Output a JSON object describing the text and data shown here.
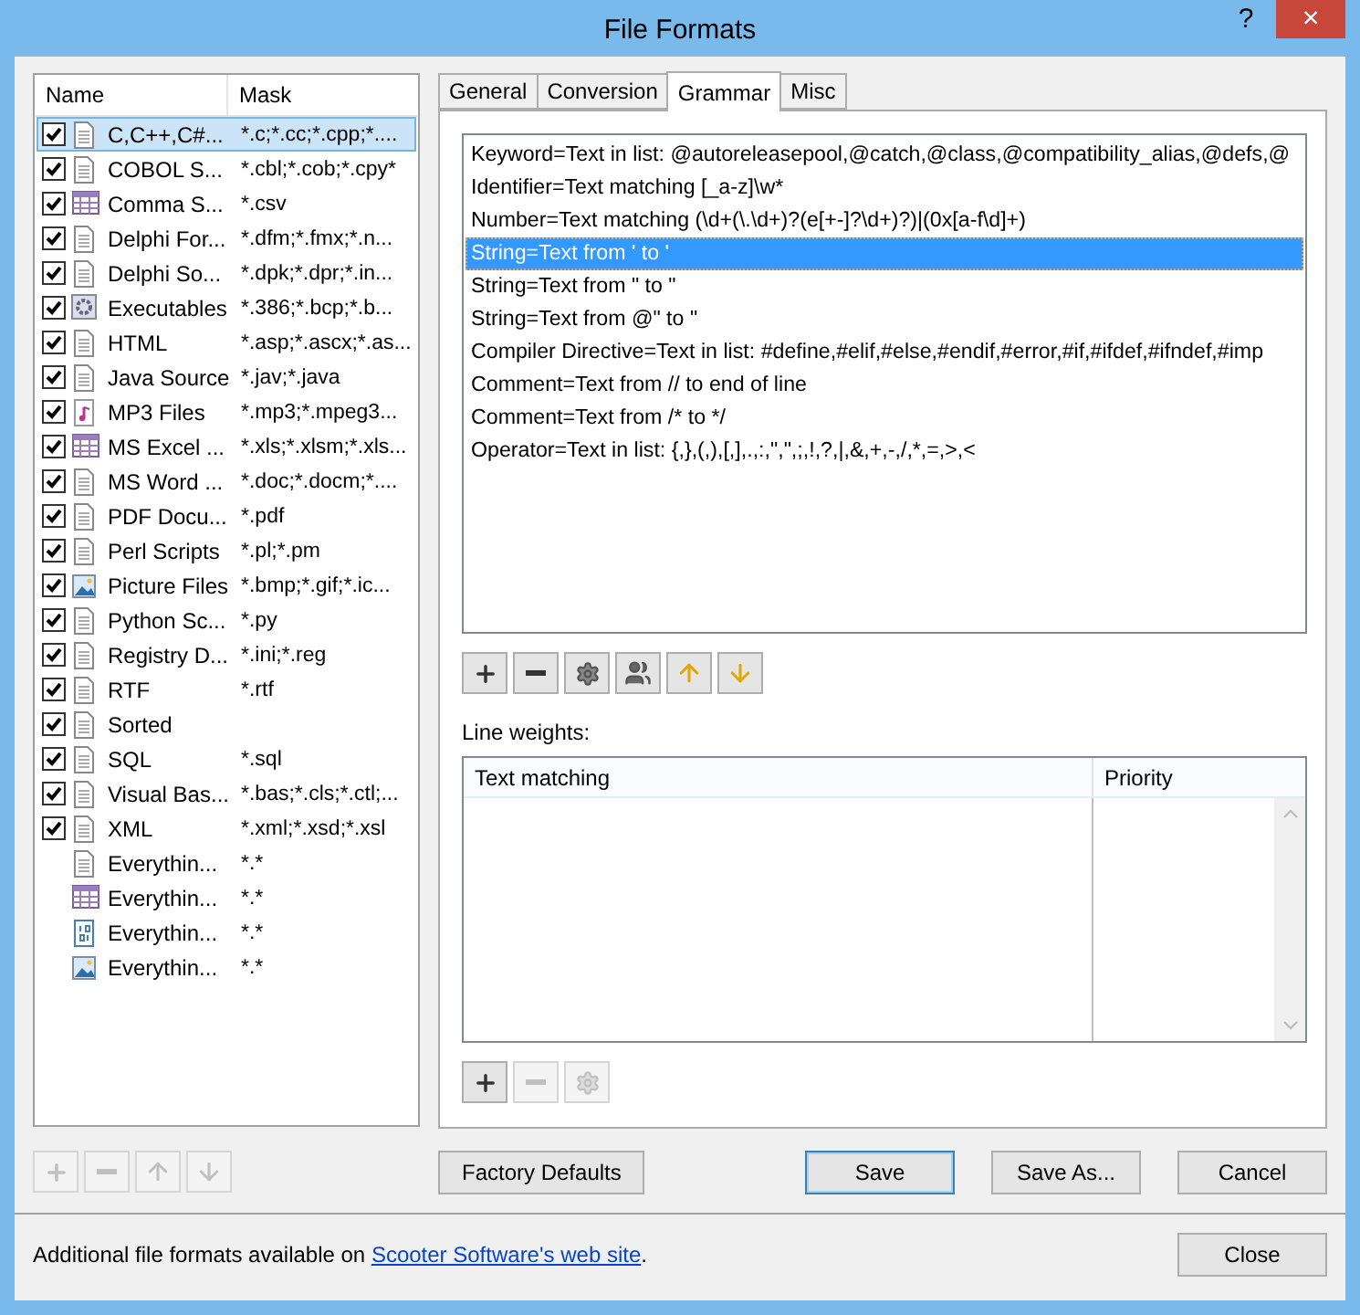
{
  "window": {
    "title": "File Formats",
    "help": "?",
    "close": "×"
  },
  "formats": {
    "columns": [
      "Name",
      "Mask"
    ],
    "items": [
      {
        "name": "C,C++,C#...",
        "mask": "*.c;*.cc;*.cpp;*....",
        "kind": "doc",
        "checked": true,
        "selected": true
      },
      {
        "name": "COBOL S...",
        "mask": "*.cbl;*.cob;*.cpy*",
        "kind": "doc",
        "checked": true,
        "selected": false
      },
      {
        "name": "Comma S...",
        "mask": "*.csv",
        "kind": "table",
        "checked": true,
        "selected": false
      },
      {
        "name": "Delphi For...",
        "mask": "*.dfm;*.fmx;*.n...",
        "kind": "doc",
        "checked": true,
        "selected": false
      },
      {
        "name": "Delphi So...",
        "mask": "*.dpk;*.dpr;*.in...",
        "kind": "doc",
        "checked": true,
        "selected": false
      },
      {
        "name": "Executables",
        "mask": "*.386;*.bcp;*.b...",
        "kind": "exe",
        "checked": true,
        "selected": false
      },
      {
        "name": "HTML",
        "mask": "*.asp;*.ascx;*.as...",
        "kind": "doc",
        "checked": true,
        "selected": false
      },
      {
        "name": "Java Source",
        "mask": "*.jav;*.java",
        "kind": "doc",
        "checked": true,
        "selected": false
      },
      {
        "name": "MP3 Files",
        "mask": "*.mp3;*.mpeg3...",
        "kind": "music",
        "checked": true,
        "selected": false
      },
      {
        "name": "MS Excel ...",
        "mask": "*.xls;*.xlsm;*.xls...",
        "kind": "table",
        "checked": true,
        "selected": false
      },
      {
        "name": "MS Word ...",
        "mask": "*.doc;*.docm;*....",
        "kind": "doc",
        "checked": true,
        "selected": false
      },
      {
        "name": "PDF Docu...",
        "mask": "*.pdf",
        "kind": "doc",
        "checked": true,
        "selected": false
      },
      {
        "name": "Perl Scripts",
        "mask": "*.pl;*.pm",
        "kind": "doc",
        "checked": true,
        "selected": false
      },
      {
        "name": "Picture Files",
        "mask": "*.bmp;*.gif;*.ic...",
        "kind": "picture",
        "checked": true,
        "selected": false
      },
      {
        "name": "Python Sc...",
        "mask": "*.py",
        "kind": "doc",
        "checked": true,
        "selected": false
      },
      {
        "name": "Registry D...",
        "mask": "*.ini;*.reg",
        "kind": "doc",
        "checked": true,
        "selected": false
      },
      {
        "name": "RTF",
        "mask": "*.rtf",
        "kind": "doc",
        "checked": true,
        "selected": false
      },
      {
        "name": "Sorted",
        "kind": "doc",
        "checked": true,
        "selected": false
      },
      {
        "name": "SQL",
        "mask": "*.sql",
        "kind": "doc",
        "checked": true,
        "selected": false
      },
      {
        "name": "Visual Bas...",
        "mask": "*.bas;*.cls;*.ctl;...",
        "kind": "doc",
        "checked": true,
        "selected": false
      },
      {
        "name": "XML",
        "mask": "*.xml;*.xsd;*.xsl",
        "kind": "doc",
        "checked": true,
        "selected": false
      },
      {
        "name": "Everythin...",
        "mask": "*.*",
        "kind": "doc",
        "selected": false
      },
      {
        "name": "Everythin...",
        "mask": "*.*",
        "kind": "table",
        "selected": false
      },
      {
        "name": "Everythin...",
        "mask": "*.*",
        "kind": "binary",
        "selected": false
      },
      {
        "name": "Everythin...",
        "mask": "*.*",
        "kind": "picture",
        "selected": false
      }
    ],
    "toolbar": [
      {
        "kind": "add",
        "disabled": true
      },
      {
        "kind": "remove",
        "disabled": true
      },
      {
        "kind": "up",
        "disabled": true
      },
      {
        "kind": "down",
        "disabled": true
      }
    ]
  },
  "tabs": [
    {
      "label": "General",
      "selected": false
    },
    {
      "label": "Conversion",
      "selected": false
    },
    {
      "label": "Grammar",
      "selected": true
    },
    {
      "label": "Misc",
      "selected": false
    }
  ],
  "grammar": {
    "rules": [
      {
        "text": "Keyword=Text in list: @autoreleasepool,@catch,@class,@compatibility_alias,@defs,@",
        "selected": false
      },
      {
        "text": "Identifier=Text matching [_a-z]\\w*",
        "selected": false
      },
      {
        "text": "Number=Text matching (\\d+(\\.\\d+)?(e[+-]?\\d+)?)|(0x[a-f\\d]+)",
        "selected": false
      },
      {
        "text": "String=Text from ' to '",
        "selected": true
      },
      {
        "text": "String=Text from \" to \"",
        "selected": false
      },
      {
        "text": "String=Text from @\" to \"",
        "selected": false
      },
      {
        "text": "Compiler Directive=Text in list: #define,#elif,#else,#endif,#error,#if,#ifdef,#ifndef,#imp",
        "selected": false
      },
      {
        "text": "Comment=Text from // to end of line",
        "selected": false
      },
      {
        "text": "Comment=Text from /* to */",
        "selected": false
      },
      {
        "text": "Operator=Text in list: {,},(,),[,],.,:,\",\",;,!,?,|,&,+,-,/,*,=,>,<",
        "selected": false
      }
    ],
    "toolbar": [
      {
        "kind": "add",
        "disabled": false
      },
      {
        "kind": "remove",
        "disabled": false
      },
      {
        "kind": "settings",
        "disabled": false
      },
      {
        "kind": "users",
        "disabled": false
      },
      {
        "kind": "up",
        "disabled": false
      },
      {
        "kind": "down",
        "disabled": false
      }
    ],
    "weights_label": "Line weights:",
    "weights_columns": [
      "Text matching",
      "Priority"
    ],
    "weights_toolbar": [
      {
        "kind": "add",
        "disabled": false
      },
      {
        "kind": "remove",
        "disabled": true
      },
      {
        "kind": "settings",
        "disabled": true
      }
    ]
  },
  "buttons": [
    {
      "label": "Factory Defaults",
      "focused": false
    },
    {
      "label": "Save",
      "focused": true
    },
    {
      "label": "Save As...",
      "focused": false
    },
    {
      "label": "Cancel",
      "focused": false
    }
  ],
  "footer": {
    "text": "Additional file formats available on ",
    "link": "Scooter Software's web site",
    "after": ".",
    "close": "Close"
  }
}
